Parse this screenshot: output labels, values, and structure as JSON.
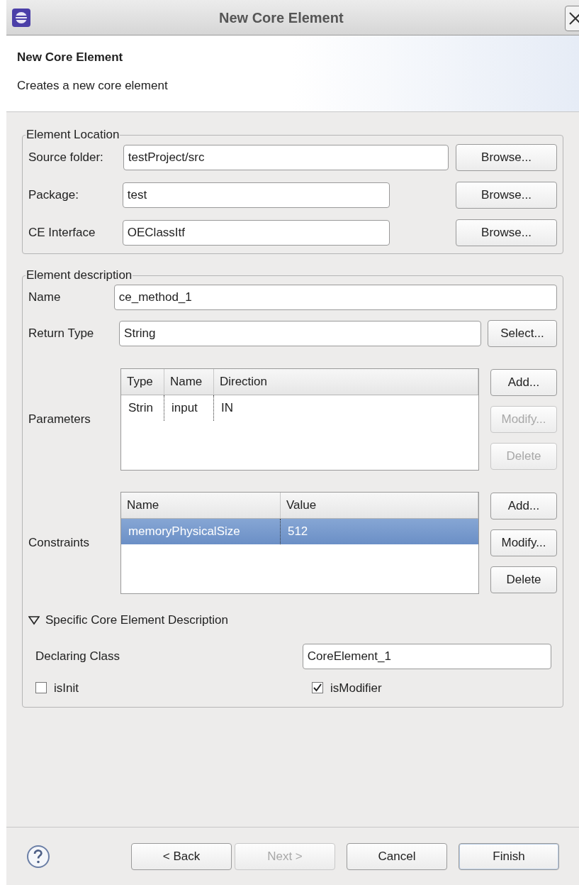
{
  "window": {
    "title": "New Core Element"
  },
  "header": {
    "title": "New Core Element",
    "description": "Creates a new core element"
  },
  "element_location": {
    "title": "Element Location",
    "rows": [
      {
        "label": "Source folder:",
        "value": "testProject/src",
        "button": "Browse..."
      },
      {
        "label": "Package:",
        "value": "test",
        "button": "Browse..."
      },
      {
        "label": "CE Interface",
        "value": "OEClassItf",
        "button": "Browse..."
      }
    ]
  },
  "element_description": {
    "title": "Element description",
    "name": {
      "label": "Name",
      "value": "ce_method_1"
    },
    "return_type": {
      "label": "Return Type",
      "value": "String",
      "button": "Select..."
    },
    "tables": [
      {
        "label": "Parameters",
        "columns": [
          "Type",
          "Name",
          "Direction"
        ],
        "rows": [
          {
            "cells": [
              "Strin",
              "input",
              "IN"
            ],
            "selected": false
          }
        ],
        "buttons": [
          {
            "label": "Add...",
            "disabled": false
          },
          {
            "label": "Modify...",
            "disabled": true
          },
          {
            "label": "Delete",
            "disabled": true
          }
        ]
      },
      {
        "label": "Constraints",
        "columns": [
          "Name",
          "Value"
        ],
        "rows": [
          {
            "cells": [
              "memoryPhysicalSize",
              "512"
            ],
            "selected": true
          }
        ],
        "buttons": [
          {
            "label": "Add...",
            "disabled": false
          },
          {
            "label": "Modify...",
            "disabled": false
          },
          {
            "label": "Delete",
            "disabled": false
          }
        ]
      }
    ],
    "specific": {
      "title": "Specific Core Element Description",
      "expanded": true,
      "declaring_class": {
        "label": "Declaring Class",
        "value": "CoreElement_1"
      },
      "checkboxes": [
        {
          "label": "isInit",
          "checked": false
        },
        {
          "label": "isModifier",
          "checked": true
        }
      ]
    }
  },
  "footer": {
    "buttons": [
      {
        "label": "< Back",
        "disabled": false,
        "default": false
      },
      {
        "label": "Next >",
        "disabled": true,
        "default": false
      },
      {
        "label": "Cancel",
        "disabled": false,
        "default": false
      },
      {
        "label": "Finish",
        "disabled": false,
        "default": true
      }
    ]
  }
}
